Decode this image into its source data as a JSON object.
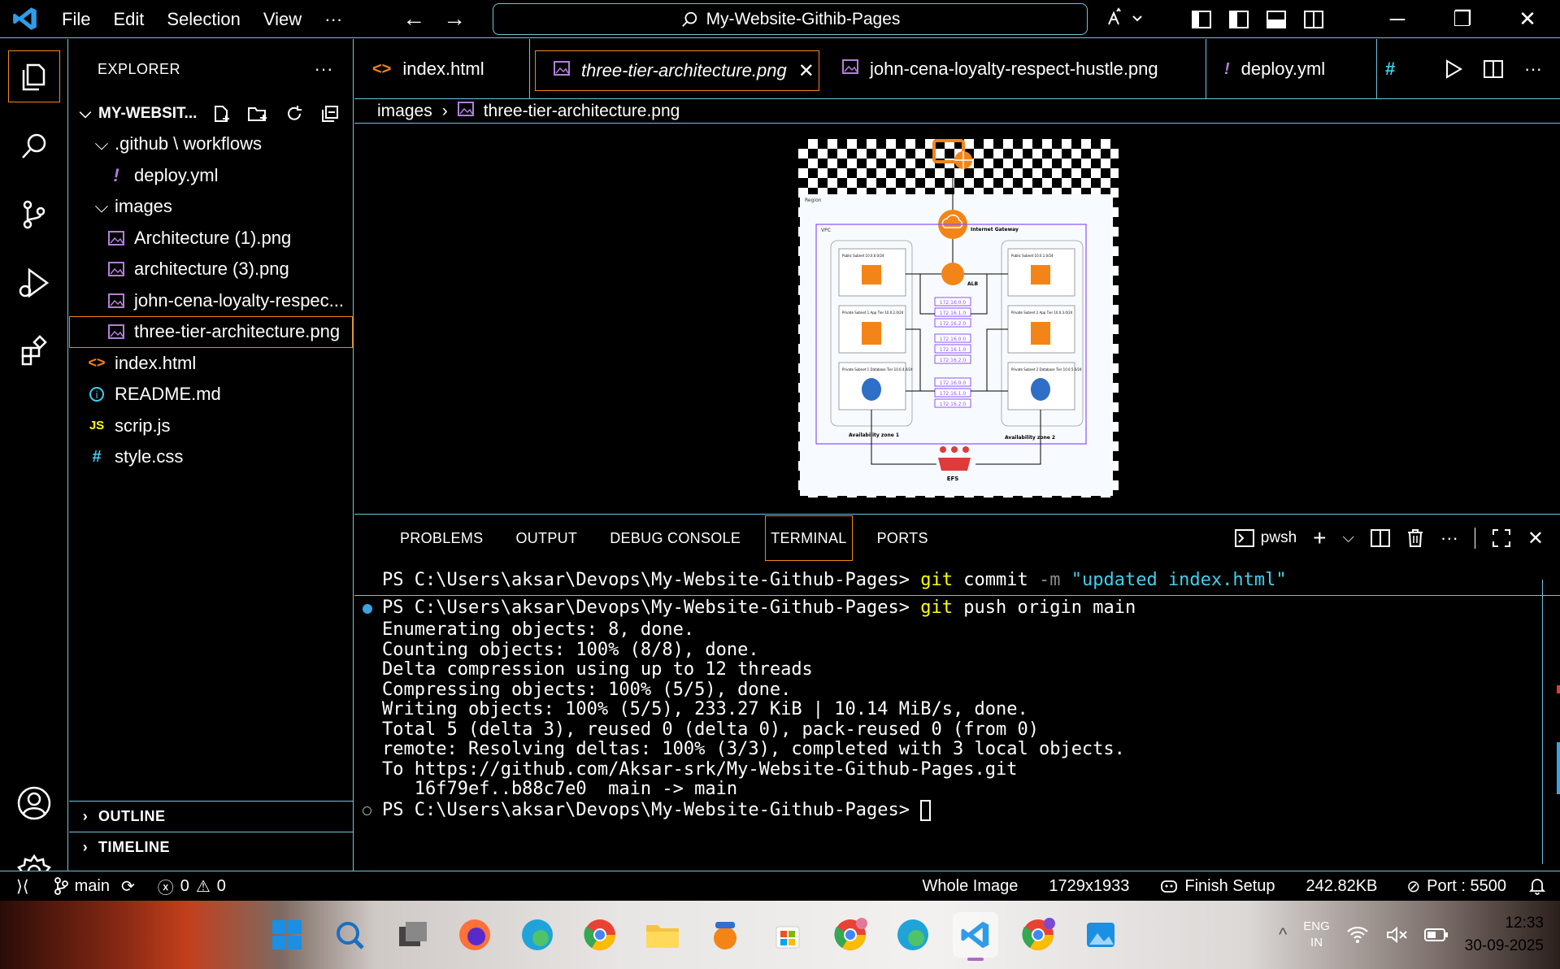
{
  "titlebar": {
    "menu": [
      "File",
      "Edit",
      "Selection",
      "View",
      "···"
    ],
    "search_text": "My-Website-Githib-Pages"
  },
  "sidebar": {
    "header": "EXPLORER",
    "header_more": "···",
    "folder": "MY-WEBSIT...",
    "tree": [
      {
        "label": ".github \\ workflows",
        "type": "folder",
        "depth": 1
      },
      {
        "label": "deploy.yml",
        "type": "yml",
        "depth": 2
      },
      {
        "label": "images",
        "type": "folder",
        "depth": 1
      },
      {
        "label": "Architecture (1).png",
        "type": "png",
        "depth": 2
      },
      {
        "label": "architecture (3).png",
        "type": "png",
        "depth": 2
      },
      {
        "label": "john-cena-loyalty-respec...",
        "type": "png",
        "depth": 2
      },
      {
        "label": "three-tier-architecture.png",
        "type": "png",
        "depth": 2,
        "selected": true
      },
      {
        "label": "index.html",
        "type": "html",
        "depth": 1
      },
      {
        "label": "README.md",
        "type": "md",
        "depth": 1
      },
      {
        "label": "scrip.js",
        "type": "js",
        "depth": 1
      },
      {
        "label": "style.css",
        "type": "css",
        "depth": 1
      }
    ],
    "outline": "OUTLINE",
    "timeline": "TIMELINE"
  },
  "tabs": [
    {
      "label": "index.html",
      "glyph": "<>",
      "color": "#f38518"
    },
    {
      "label": "three-tier-architecture.png",
      "glyph": "▣",
      "color": "#b180d7",
      "active": true
    },
    {
      "label": "john-cena-loyalty-respect-hustle.png",
      "glyph": "▣",
      "color": "#b180d7"
    },
    {
      "label": "deploy.yml",
      "glyph": "!",
      "color": "#b180d7"
    }
  ],
  "breadcrumb": {
    "folder": "images",
    "file": "three-tier-architecture.png"
  },
  "diagram": {
    "region": "Region",
    "vpc": "VPC",
    "igw": "Internet Gateway",
    "alb": "ALB",
    "efs": "EFS",
    "az1": "Availability zone 1",
    "az2": "Availability zone 2",
    "pub1": "Public Subnet 10.0.0.0/24",
    "pub2": "Public Subnet 10.0.1.0/24",
    "app1": "Private Subnet 1 App Tier 10.0.2.0/24",
    "app2": "Private Subnet 2 App Tier 10.0.3.0/24",
    "db1": "Private Subnet 1 Database Tier 10.0.4.0/24",
    "db2": "Private Subnet 2 Database Tier 10.0.5.0/24",
    "cidrs": [
      "172.16.0.0",
      "172.16.1.0",
      "172.16.2.0"
    ]
  },
  "panel": {
    "tabs": [
      "PROBLEMS",
      "OUTPUT",
      "DEBUG CONSOLE",
      "TERMINAL",
      "PORTS"
    ],
    "active_tab": "TERMINAL",
    "shell": "pwsh"
  },
  "terminal": {
    "sticky_prompt": "PS C:\\Users\\aksar\\Devops\\My-Website-Github-Pages> ",
    "sticky_cmd": "git",
    "sticky_args": " commit ",
    "sticky_flag": "-m",
    "sticky_str": " \"updated index.html\"",
    "push_prompt": "PS C:\\Users\\aksar\\Devops\\My-Website-Github-Pages> ",
    "push_cmd": "git",
    "push_args": " push origin main",
    "output": [
      "Enumerating objects: 8, done.",
      "Counting objects: 100% (8/8), done.",
      "Delta compression using up to 12 threads",
      "Compressing objects: 100% (5/5), done.",
      "Writing objects: 100% (5/5), 233.27 KiB | 10.14 MiB/s, done.",
      "Total 5 (delta 3), reused 0 (delta 0), pack-reused 0 (from 0)",
      "remote: Resolving deltas: 100% (3/3), completed with 3 local objects.",
      "To https://github.com/Aksar-srk/My-Website-Github-Pages.git",
      "   16f79ef..b88c7e0  main -> main"
    ],
    "final_prompt": "PS C:\\Users\\aksar\\Devops\\My-Website-Github-Pages> "
  },
  "statusbar": {
    "branch": "main",
    "errors": "0",
    "warnings": "0",
    "image_mode": "Whole Image",
    "dimensions": "1729x1933",
    "finish_setup": "Finish Setup",
    "size": "242.82KB",
    "port": "Port : 5500"
  },
  "taskbar": {
    "lang1": "ENG",
    "lang2": "IN",
    "time": "12:33",
    "date": "30-09-2025"
  },
  "colors": {
    "contrast_border": "#6fc3df",
    "active_border": "#f38518",
    "yellow": "#ffff00",
    "cyan": "#3fd0ef"
  }
}
